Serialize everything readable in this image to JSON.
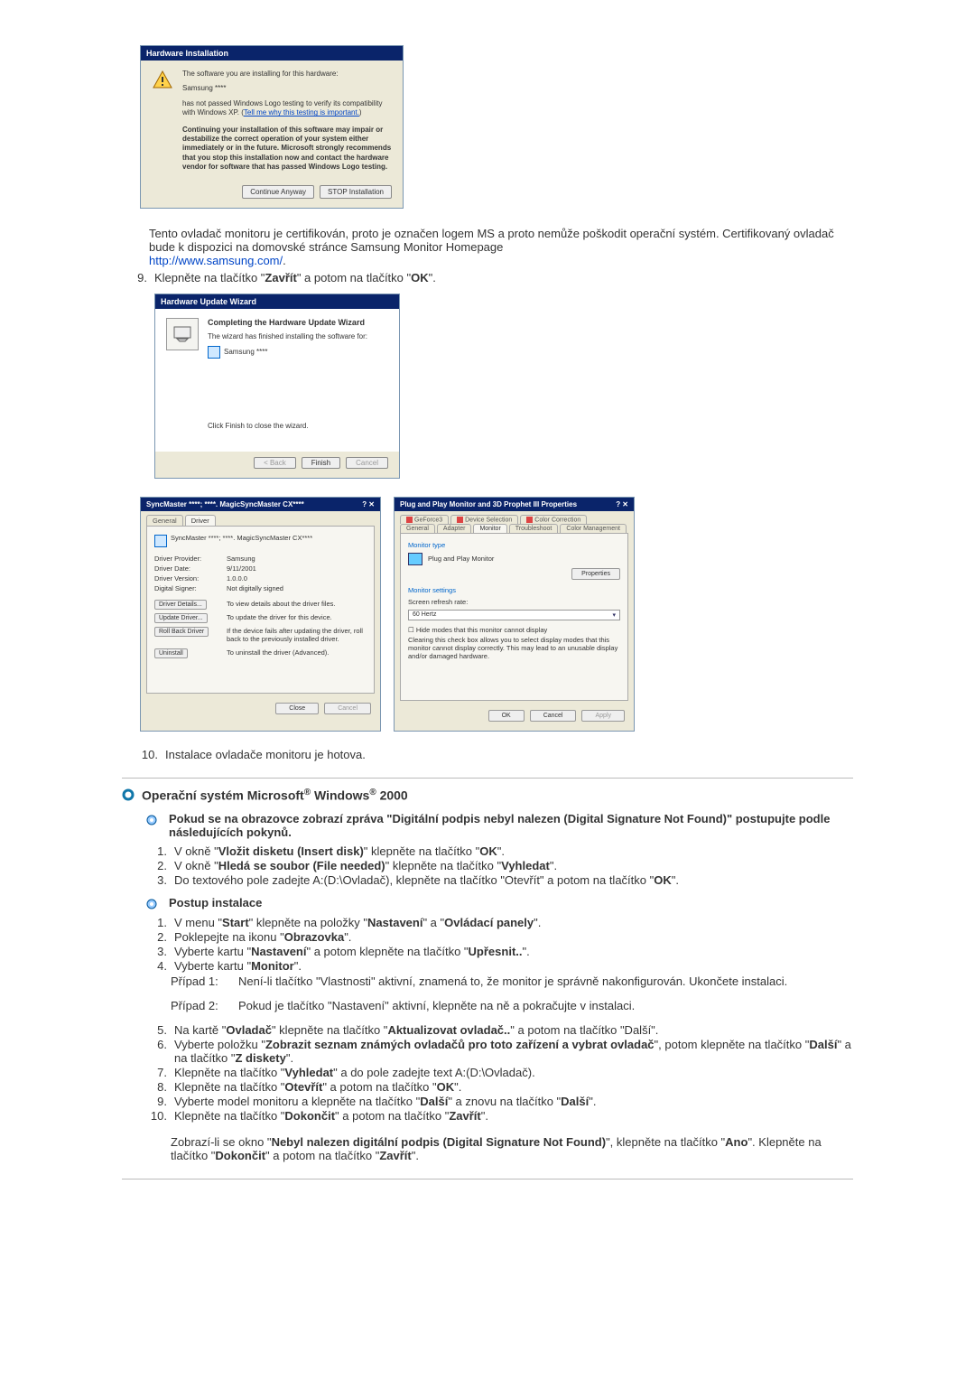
{
  "warn_dlg": {
    "title": "Hardware Installation",
    "line1": "The software you are installing for this hardware:",
    "device": "Samsung ****",
    "line2a": "has not passed Windows Logo testing to verify its compatibility with Windows XP. (",
    "line2_link": "Tell me why this testing is important.",
    "line2b": ")",
    "para_bold": "Continuing your installation of this software may impair or destabilize the correct operation of your system either immediately or in the future. Microsoft strongly recommends that you stop this installation now and contact the hardware vendor for software that has passed Windows Logo testing.",
    "btn_continue": "Continue Anyway",
    "btn_stop": "STOP Installation"
  },
  "para_after_warn": "Tento ovladač monitoru je certifikován, proto je označen logem MS a proto nemůže poškodit operační systém. Certifikovaný ovladač bude k dispozici na domovské stránce Samsung Monitor Homepage",
  "link_samsung": "http://www.samsung.com/",
  "step9_n": "9.",
  "step9_a": "Klepněte na tlačítko \"",
  "step9_b": "Zavřít",
  "step9_c": "\" a potom na tlačítko \"",
  "step9_d": "OK",
  "step9_e": "\".",
  "wizard": {
    "title": "Hardware Update Wizard",
    "completing": "Completing the Hardware Update Wizard",
    "finished": "The wizard has finished installing the software for:",
    "device": "Samsung ****",
    "click_finish": "Click Finish to close the wizard.",
    "back": "< Back",
    "finish": "Finish",
    "cancel": "Cancel"
  },
  "prop_driver": {
    "title": "SyncMaster ****; ****. MagicSyncMaster CX****",
    "tab_general": "General",
    "tab_driver": "Driver",
    "device_line": "SyncMaster ****; ****. MagicSyncMaster CX****",
    "prov_k": "Driver Provider:",
    "prov_v": "Samsung",
    "date_k": "Driver Date:",
    "date_v": "9/11/2001",
    "ver_k": "Driver Version:",
    "ver_v": "1.0.0.0",
    "sign_k": "Digital Signer:",
    "sign_v": "Not digitally signed",
    "btn_details": "Driver Details...",
    "desc_details": "To view details about the driver files.",
    "btn_update": "Update Driver...",
    "desc_update": "To update the driver for this device.",
    "btn_roll": "Roll Back Driver",
    "desc_roll": "If the device fails after updating the driver, roll back to the previously installed driver.",
    "btn_uninstall": "Uninstall",
    "desc_uninstall": "To uninstall the driver (Advanced).",
    "btn_close": "Close",
    "btn_cancel": "Cancel"
  },
  "prop_monitor": {
    "title": "Plug and Play Monitor and 3D Prophet III Properties",
    "tabs1": [
      "GeForce3",
      "Device Selection",
      "Color Correction"
    ],
    "tabs2": [
      "General",
      "Adapter",
      "Monitor",
      "Troubleshoot",
      "Color Management"
    ],
    "mt_type": "Monitor type",
    "mt_value": "Plug and Play Monitor",
    "btn_properties": "Properties",
    "mon_sett": "Monitor settings",
    "refresh_lbl": "Screen refresh rate:",
    "refresh_val": "60 Hertz",
    "hide": "Hide modes that this monitor cannot display",
    "hide_desc": "Clearing this check box allows you to select display modes that this monitor cannot display correctly. This may lead to an unusable display and/or damaged hardware.",
    "btn_ok": "OK",
    "btn_cancel": "Cancel",
    "btn_apply": "Apply"
  },
  "step10_n": "10.",
  "step10_text": "Instalace ovladače monitoru je hotova.",
  "heading_a": "Operační systém Microsoft",
  "heading_b": " Windows",
  "heading_c": " 2000",
  "dss": {
    "intro": "Pokud se na obrazovce zobrazí zpráva \"Digitální podpis nebyl nalezen (Digital Signature Not Found)\" postupujte podle následujících pokynů.",
    "items": [
      "V okně \"<b>Vložit disketu (Insert disk)</b>\" klepněte na tlačítko \"<b>OK</b>\".",
      "V okně \"<b>Hledá se soubor (File needed)</b>\" klepněte na tlačítko \"<b>Vyhledat</b>\".",
      "Do textového pole zadejte A:(D:\\Ovladač), klepněte na tlačítko \"Otevřít\" a potom na tlačítko \"<b>OK</b>\"."
    ]
  },
  "postup_title": "Postup instalace",
  "postup": {
    "items": [
      "V menu \"<b>Start</b>\" klepněte na položky \"<b>Nastavení</b>\" a \"<b>Ovládací panely</b>\".",
      "Poklepejte na ikonu \"<b>Obrazovka</b>\".",
      "Vyberte kartu \"<b>Nastavení</b>\" a potom klepněte na tlačítko \"<b>Upřesnit..</b>\".",
      "Vyberte kartu \"<b>Monitor</b>\"."
    ],
    "case1_lbl": "Případ 1:",
    "case1_body": "Není-li tlačítko \"Vlastnosti\" aktivní, znamená to, že monitor je správně nakonfigurován. Ukončete instalaci.",
    "case2_lbl": "Případ 2:",
    "case2_body": "Pokud je tlačítko \"Nastavení\" aktivní, klepněte na ně a pokračujte v instalaci.",
    "items2": [
      "Na kartě \"<b>Ovladač</b>\" klepněte na tlačítko \"<b>Aktualizovat ovladač..</b>\" a potom na tlačítko \"Další\".",
      "Vyberte položku \"<b>Zobrazit seznam známých ovladačů pro toto zařízení a vybrat ovladač</b>\", potom klepněte na tlačítko \"<b>Další</b>\" a na tlačítko \"<b>Z diskety</b>\".",
      "Klepněte na tlačítko \"<b>Vyhledat</b>\" a do pole zadejte text A:(D:\\Ovladač).",
      "Klepněte na tlačítko \"<b>Otevřít</b>\" a potom na tlačítko \"<b>OK</b>\".",
      "Vyberte model monitoru a klepněte na tlačítko \"<b>Další</b>\" a znovu na tlačítko \"<b>Další</b>\".",
      "Klepněte na tlačítko \"<b>Dokončit</b>\" a potom na tlačítko \"<b>Zavřít</b>\"."
    ],
    "final": "Zobrazí-li se okno \"<b>Nebyl nalezen digitální podpis (Digital Signature Not Found)</b>\", klepněte na tlačítko \"<b>Ano</b>\". Klepněte na tlačítko \"<b>Dokončit</b>\" a potom na tlačítko \"<b>Zavřít</b>\"."
  }
}
